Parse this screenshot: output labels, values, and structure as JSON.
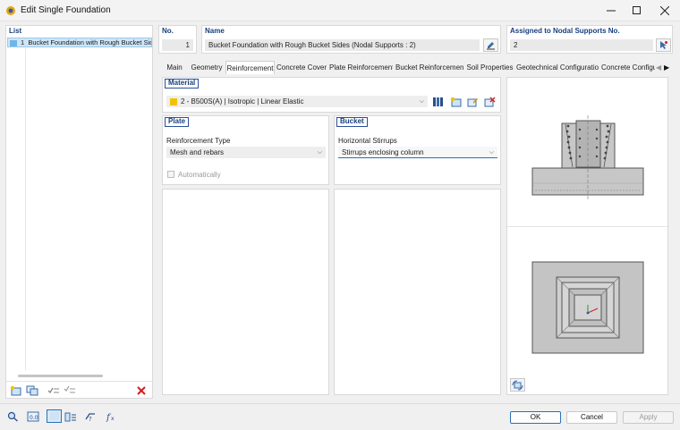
{
  "window": {
    "title": "Edit Single Foundation"
  },
  "list": {
    "label": "List",
    "items": [
      {
        "no": "1",
        "name": "Bucket Foundation with Rough Bucket Sides"
      }
    ]
  },
  "header": {
    "no_label": "No.",
    "no_value": "1",
    "name_label": "Name",
    "name_value": "Bucket Foundation with Rough Bucket Sides (Nodal Supports : 2)",
    "assigned_label": "Assigned to Nodal Supports No.",
    "assigned_value": "2"
  },
  "tabs": [
    {
      "label": "Main"
    },
    {
      "label": "Geometry"
    },
    {
      "label": "Reinforcement"
    },
    {
      "label": "Concrete Cover"
    },
    {
      "label": "Plate Reinforcement"
    },
    {
      "label": "Bucket Reinforcement"
    },
    {
      "label": "Soil Properties"
    },
    {
      "label": "Geotechnical Configuration"
    },
    {
      "label": "Concrete Configu"
    }
  ],
  "material": {
    "title": "Material",
    "value": "2 - B500S(A) | Isotropic | Linear Elastic",
    "swatch_color": "#f2c200"
  },
  "plate": {
    "title": "Plate",
    "reinf_type_label": "Reinforcement Type",
    "reinf_type_value": "Mesh and rebars",
    "auto_label": "Automatically"
  },
  "bucket": {
    "title": "Bucket",
    "stirrups_label": "Horizontal Stirrups",
    "stirrups_value": "Stirrups enclosing column"
  },
  "footer": {
    "ok": "OK",
    "cancel": "Cancel",
    "apply": "Apply"
  }
}
